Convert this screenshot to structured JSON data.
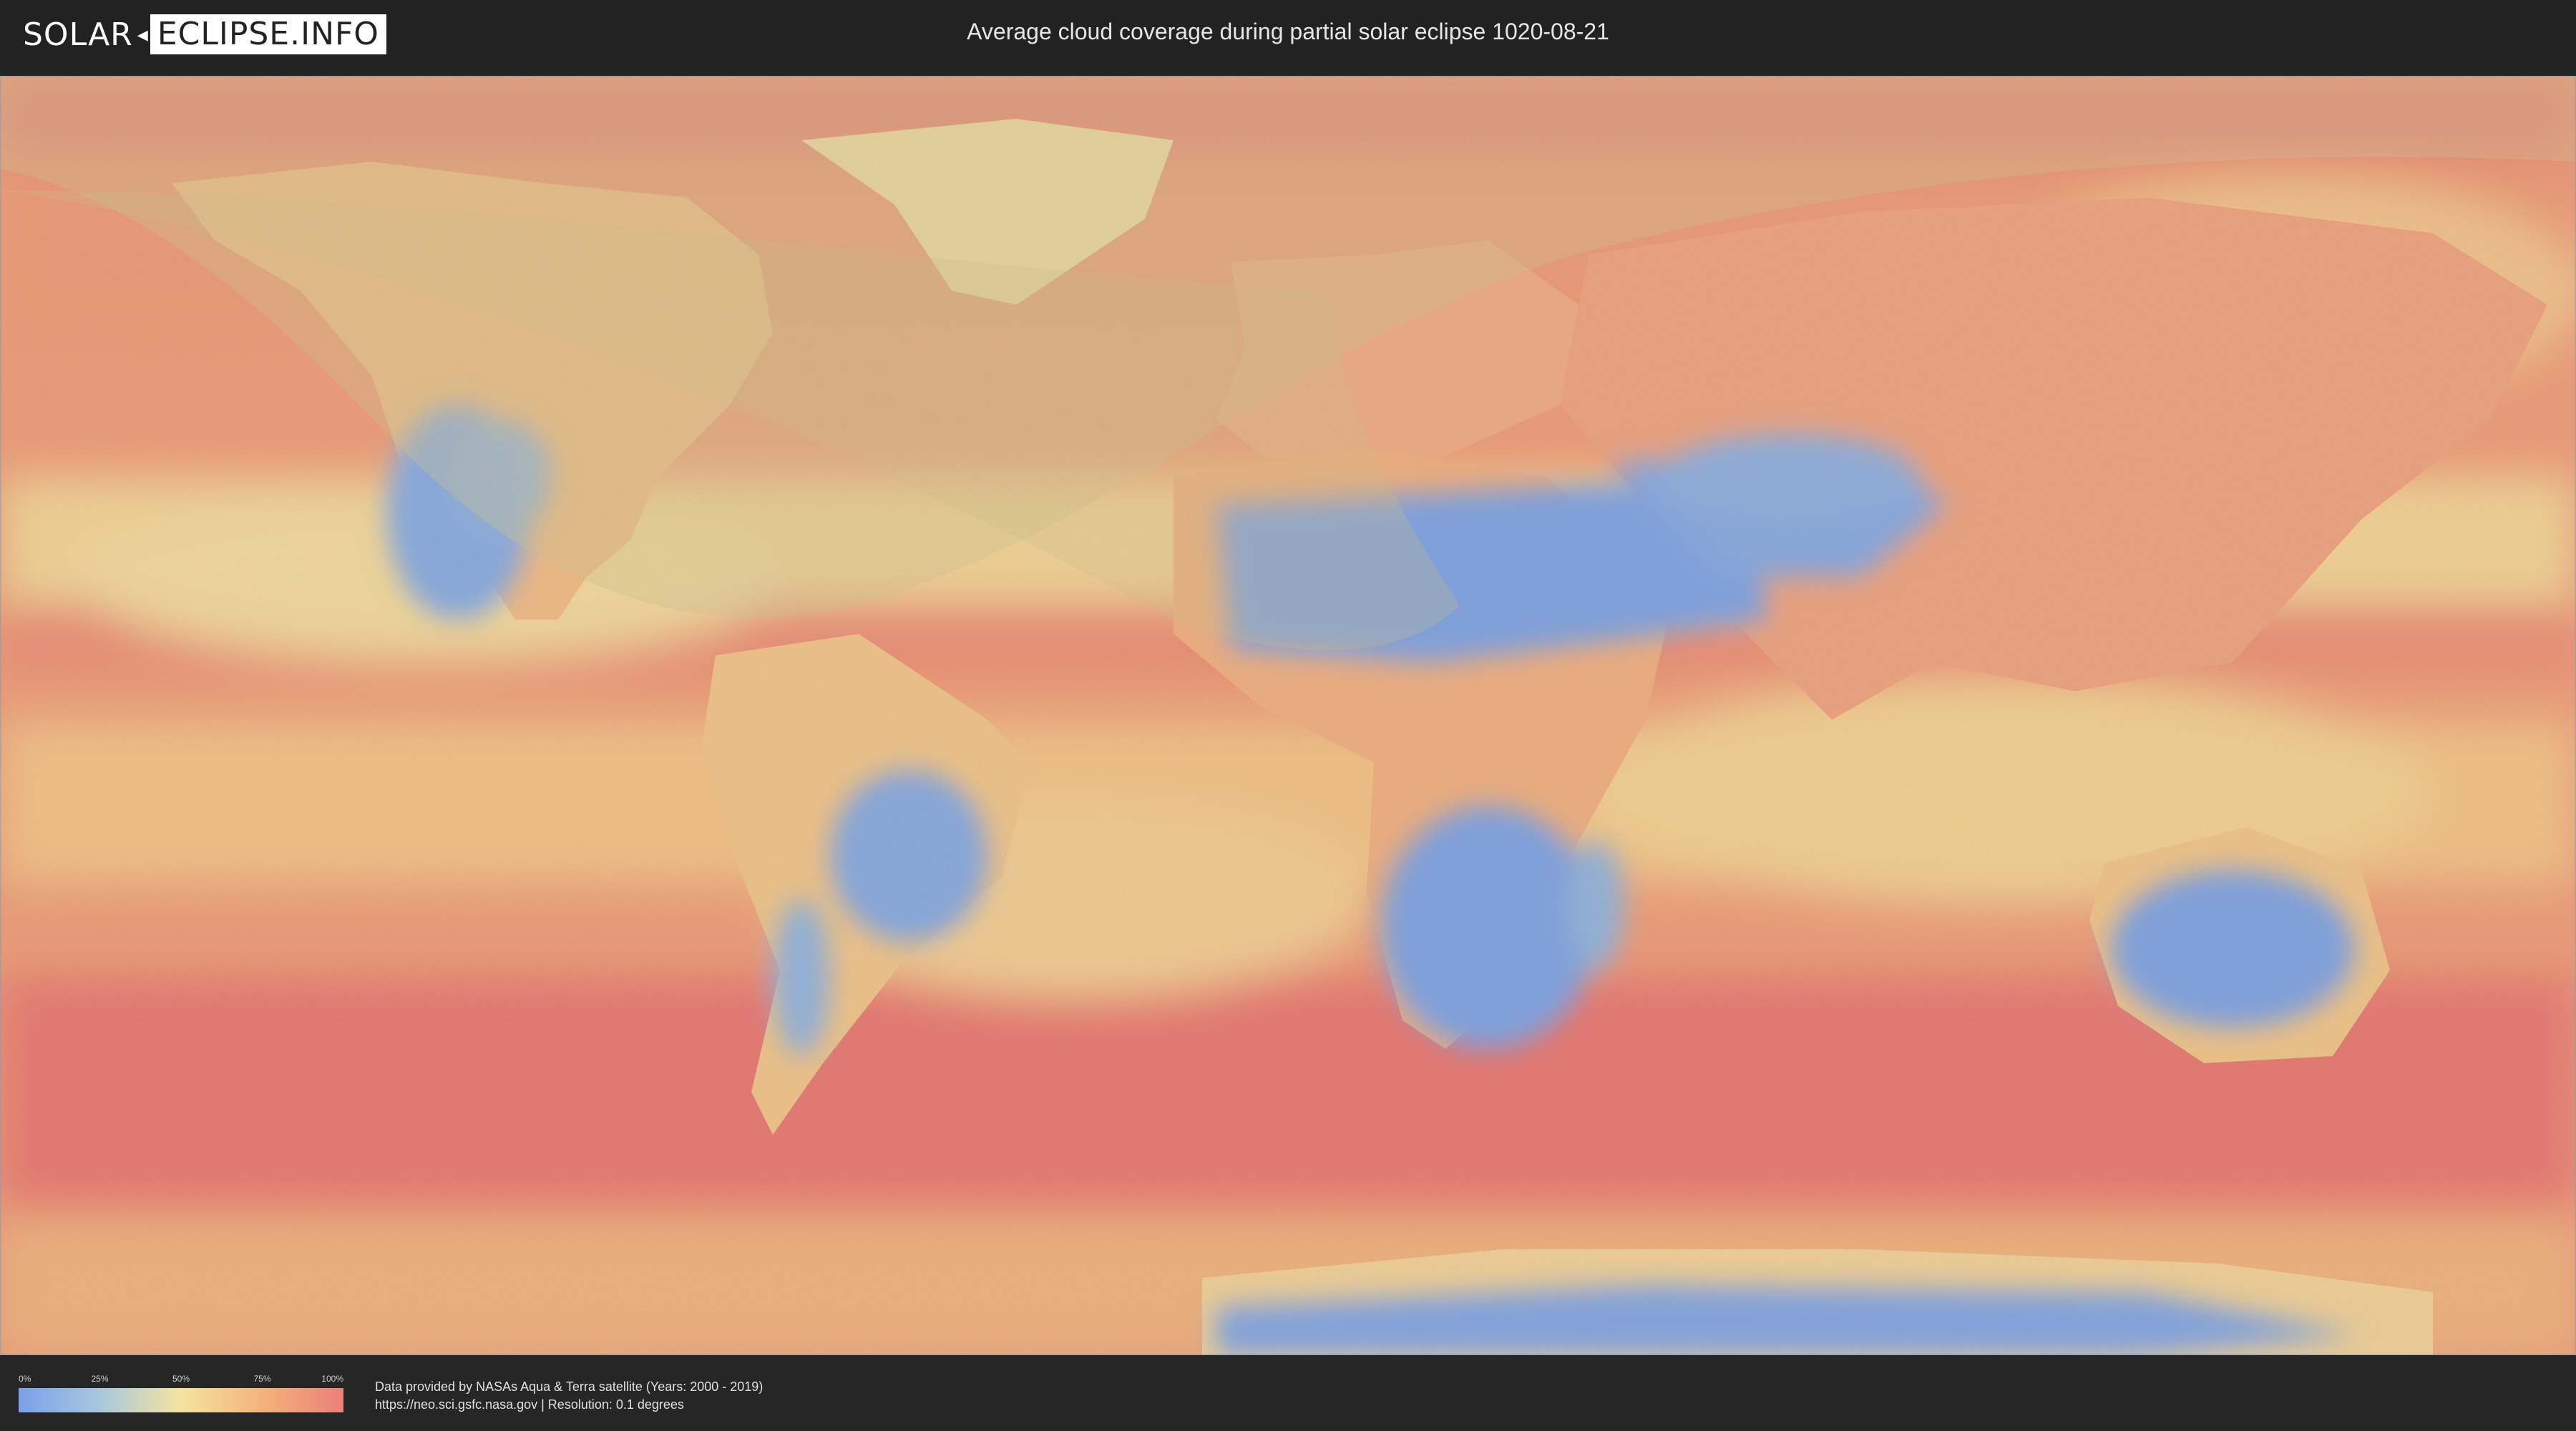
{
  "header": {
    "logo_part1": "SOLAR",
    "logo_part2": "ECLIPSE.INFO",
    "title": "Average cloud coverage during partial solar eclipse 1020-08-21"
  },
  "map": {
    "description_layer": "cloud-coverage",
    "colors": {
      "clear": "#7aa0e8",
      "low": "#a8c8de",
      "mid": "#f4e3a0",
      "high": "#f4b37a",
      "overcast": "#ec7f7a",
      "eclipse_shadow": "#d8c898"
    }
  },
  "legend": {
    "ticks": [
      "0%",
      "25%",
      "50%",
      "75%",
      "100%"
    ]
  },
  "credits": {
    "line1": "Data provided by NASAs Aqua & Terra satellite (Years: 2000 - 2019)",
    "line2": "https://neo.sci.gsfc.nasa.gov | Resolution: 0.1 degrees"
  }
}
